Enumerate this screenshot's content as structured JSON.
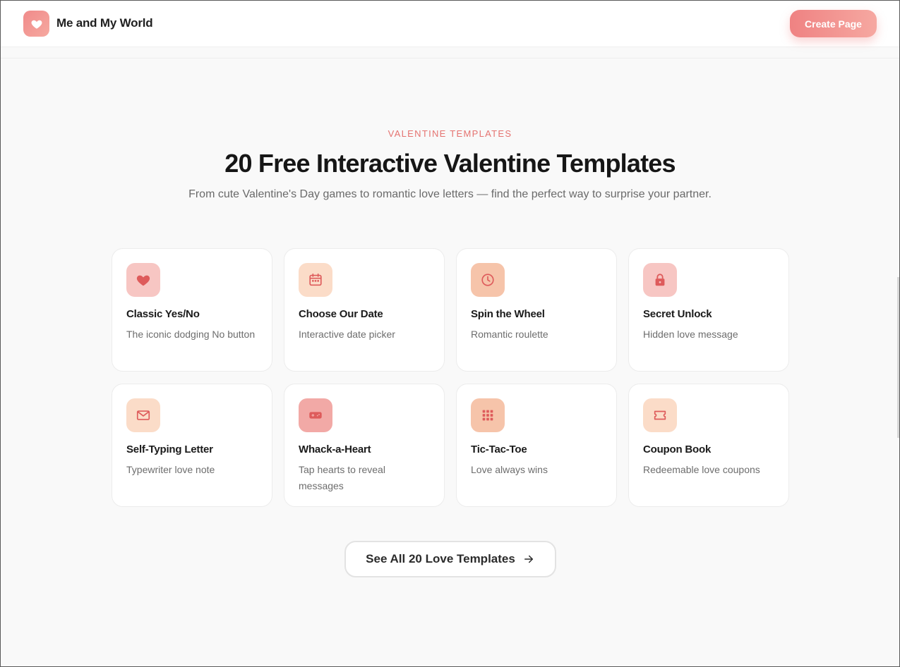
{
  "header": {
    "brand": "Me and My World",
    "cta_label": "Create Page",
    "logo_icon": "heart-icon"
  },
  "hero": {
    "eyebrow": "VALENTINE TEMPLATES",
    "title": "20 Free Interactive Valentine Templates",
    "subtitle": "From cute Valentine's Day games to romantic love letters — find the perfect way to surprise your partner."
  },
  "templates": [
    {
      "title": "Classic Yes/No",
      "desc": "The iconic dodging No button",
      "icon": "heart-icon",
      "icon_bg": "#f7c6c3"
    },
    {
      "title": "Choose Our Date",
      "desc": "Interactive date picker",
      "icon": "calendar-icon",
      "icon_bg": "#fbdcc8"
    },
    {
      "title": "Spin the Wheel",
      "desc": "Romantic roulette",
      "icon": "clock-icon",
      "icon_bg": "#f6c4aa"
    },
    {
      "title": "Secret Unlock",
      "desc": "Hidden love message",
      "icon": "lock-icon",
      "icon_bg": "#f7c6c3"
    },
    {
      "title": "Self-Typing Letter",
      "desc": "Typewriter love note",
      "icon": "envelope-icon",
      "icon_bg": "#fbdcc8"
    },
    {
      "title": "Whack-a-Heart",
      "desc": "Tap hearts to reveal messages",
      "icon": "gamepad-icon",
      "icon_bg": "#f2a9a6"
    },
    {
      "title": "Tic-Tac-Toe",
      "desc": "Love always wins",
      "icon": "grid-icon",
      "icon_bg": "#f6c4aa"
    },
    {
      "title": "Coupon Book",
      "desc": "Redeemable love coupons",
      "icon": "ticket-icon",
      "icon_bg": "#fbdcc8"
    }
  ],
  "see_all_label": "See All 20 Love Templates",
  "colors": {
    "accent": "#e57370",
    "icon_stroke": "#de5b5b",
    "button_gradient_start": "#ef8282",
    "button_gradient_end": "#f6a8a1"
  }
}
